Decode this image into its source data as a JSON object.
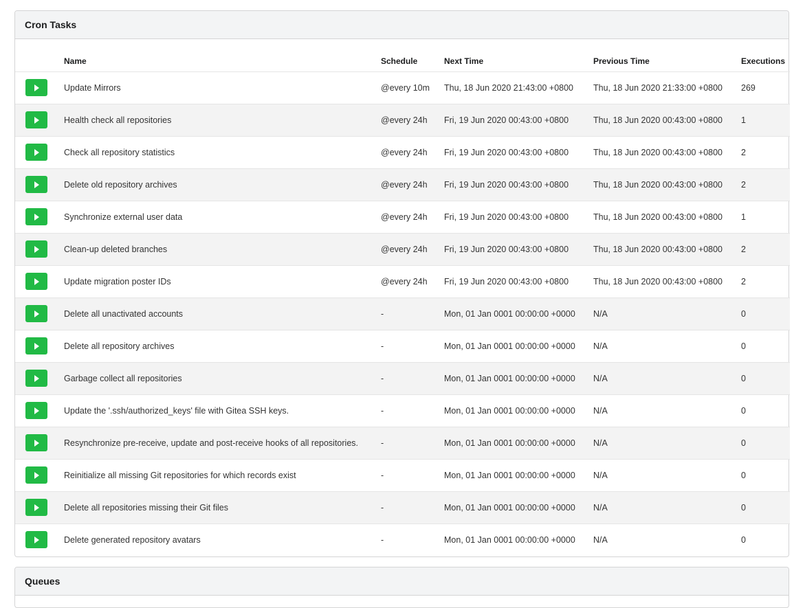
{
  "cron": {
    "title": "Cron Tasks",
    "columns": [
      "",
      "Name",
      "Schedule",
      "Next Time",
      "Previous Time",
      "Executions"
    ],
    "rows": [
      {
        "name": "Update Mirrors",
        "schedule": "@every 10m",
        "next": "Thu, 18 Jun 2020 21:43:00 +0800",
        "prev": "Thu, 18 Jun 2020 21:33:00 +0800",
        "exec": "269"
      },
      {
        "name": "Health check all repositories",
        "schedule": "@every 24h",
        "next": "Fri, 19 Jun 2020 00:43:00 +0800",
        "prev": "Thu, 18 Jun 2020 00:43:00 +0800",
        "exec": "1"
      },
      {
        "name": "Check all repository statistics",
        "schedule": "@every 24h",
        "next": "Fri, 19 Jun 2020 00:43:00 +0800",
        "prev": "Thu, 18 Jun 2020 00:43:00 +0800",
        "exec": "2"
      },
      {
        "name": "Delete old repository archives",
        "schedule": "@every 24h",
        "next": "Fri, 19 Jun 2020 00:43:00 +0800",
        "prev": "Thu, 18 Jun 2020 00:43:00 +0800",
        "exec": "2"
      },
      {
        "name": "Synchronize external user data",
        "schedule": "@every 24h",
        "next": "Fri, 19 Jun 2020 00:43:00 +0800",
        "prev": "Thu, 18 Jun 2020 00:43:00 +0800",
        "exec": "1"
      },
      {
        "name": "Clean-up deleted branches",
        "schedule": "@every 24h",
        "next": "Fri, 19 Jun 2020 00:43:00 +0800",
        "prev": "Thu, 18 Jun 2020 00:43:00 +0800",
        "exec": "2"
      },
      {
        "name": "Update migration poster IDs",
        "schedule": "@every 24h",
        "next": "Fri, 19 Jun 2020 00:43:00 +0800",
        "prev": "Thu, 18 Jun 2020 00:43:00 +0800",
        "exec": "2"
      },
      {
        "name": "Delete all unactivated accounts",
        "schedule": "-",
        "next": "Mon, 01 Jan 0001 00:00:00 +0000",
        "prev": "N/A",
        "exec": "0"
      },
      {
        "name": "Delete all repository archives",
        "schedule": "-",
        "next": "Mon, 01 Jan 0001 00:00:00 +0000",
        "prev": "N/A",
        "exec": "0"
      },
      {
        "name": "Garbage collect all repositories",
        "schedule": "-",
        "next": "Mon, 01 Jan 0001 00:00:00 +0000",
        "prev": "N/A",
        "exec": "0"
      },
      {
        "name": "Update the '.ssh/authorized_keys' file with Gitea SSH keys.",
        "schedule": "-",
        "next": "Mon, 01 Jan 0001 00:00:00 +0000",
        "prev": "N/A",
        "exec": "0"
      },
      {
        "name": "Resynchronize pre-receive, update and post-receive hooks of all repositories.",
        "schedule": "-",
        "next": "Mon, 01 Jan 0001 00:00:00 +0000",
        "prev": "N/A",
        "exec": "0"
      },
      {
        "name": "Reinitialize all missing Git repositories for which records exist",
        "schedule": "-",
        "next": "Mon, 01 Jan 0001 00:00:00 +0000",
        "prev": "N/A",
        "exec": "0"
      },
      {
        "name": "Delete all repositories missing their Git files",
        "schedule": "-",
        "next": "Mon, 01 Jan 0001 00:00:00 +0000",
        "prev": "N/A",
        "exec": "0"
      },
      {
        "name": "Delete generated repository avatars",
        "schedule": "-",
        "next": "Mon, 01 Jan 0001 00:00:00 +0000",
        "prev": "N/A",
        "exec": "0"
      }
    ]
  },
  "queues": {
    "title": "Queues"
  },
  "icons": {
    "run": "triangle-right-icon"
  },
  "colors": {
    "run_button": "#21ba45",
    "header_bg": "#f3f4f5",
    "stripe_bg": "#f3f3f3",
    "border": "#d4d4d5"
  }
}
